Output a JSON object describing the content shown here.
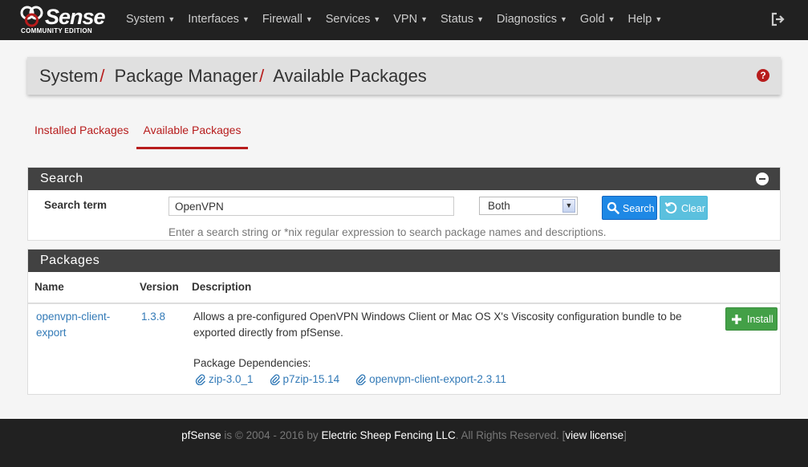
{
  "brand": {
    "logo_text": "Sense",
    "logo_subtitle": "COMMUNITY EDITION"
  },
  "nav": {
    "items": [
      {
        "label": "System"
      },
      {
        "label": "Interfaces"
      },
      {
        "label": "Firewall"
      },
      {
        "label": "Services"
      },
      {
        "label": "VPN"
      },
      {
        "label": "Status"
      },
      {
        "label": "Diagnostics"
      },
      {
        "label": "Gold"
      },
      {
        "label": "Help"
      }
    ],
    "logout_icon": "logout-icon"
  },
  "breadcrumb": {
    "part1": "System",
    "part2": "Package Manager",
    "part3": "Available Packages",
    "separator": "/"
  },
  "tabs": [
    {
      "label": "Installed Packages",
      "active": false
    },
    {
      "label": "Available Packages",
      "active": true
    }
  ],
  "search_panel": {
    "title": "Search",
    "label": "Search term",
    "input_value": "OpenVPN",
    "select_value": "Both",
    "search_button": "Search",
    "clear_button": "Clear",
    "hint": "Enter a search string or *nix regular expression to search package names and descriptions."
  },
  "packages_panel": {
    "title": "Packages",
    "columns": {
      "name": "Name",
      "version": "Version",
      "description": "Description"
    },
    "rows": [
      {
        "name": "openvpn-client-export",
        "version": "1.3.8",
        "description": "Allows a pre-configured OpenVPN Windows Client or Mac OS X's Viscosity configuration bundle to be exported directly from pfSense.",
        "dependencies_label": "Package Dependencies:",
        "dependencies": [
          "zip-3.0_1",
          "p7zip-15.14",
          "openvpn-client-export-2.3.11"
        ],
        "install_button": "Install"
      }
    ]
  },
  "footer": {
    "brand": "pfSense",
    "text1": " is © 2004 - 2016 by ",
    "company": "Electric Sheep Fencing LLC",
    "text2": ". All Rights Reserved. [",
    "license_link": "view license",
    "text3": "]"
  },
  "colors": {
    "navbar": "#212121",
    "accent_red": "#b71c1c",
    "link_blue": "#337ab7",
    "panel_heading": "#424242",
    "search_button": "#1e88e5",
    "clear_button": "#5bc0de",
    "install_button": "#43a047"
  }
}
